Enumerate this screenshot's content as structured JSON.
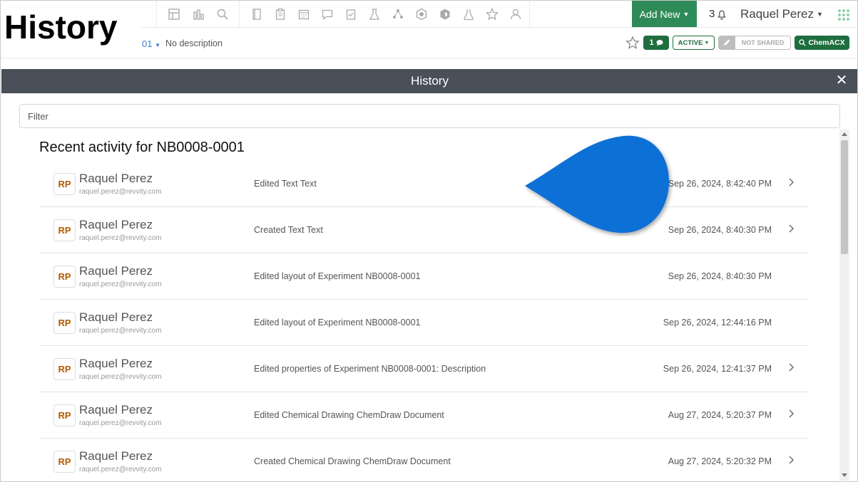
{
  "overlay_label": "History",
  "toolbar": {
    "group1_icons": [
      "dashboard-icon",
      "chart-icon",
      "search-icon"
    ],
    "group2_icons": [
      "notebook-icon",
      "clipboard-icon",
      "calendar-icon",
      "comment-icon",
      "task-icon",
      "lab-icon",
      "network-icon",
      "hexagon-icon",
      "cube-icon",
      "flask-icon",
      "star-icon",
      "people-icon"
    ],
    "add_new_label": "Add New",
    "notification_count": "3",
    "user_name": "Raquel Perez"
  },
  "experiment_bar": {
    "id_fragment": "01",
    "description": "No description",
    "comment_count": "1",
    "status_label": "ACTIVE",
    "sharing_label": "NOT SHARED",
    "chemacx_label": "ChemACX"
  },
  "modal": {
    "title": "History",
    "close_glyph": "✕",
    "filter_placeholder": "Filter",
    "heading": "Recent activity for NB0008-0001"
  },
  "activity": [
    {
      "initials": "RP",
      "name": "Raquel Perez",
      "email": "raquel.perez@revvity.com",
      "action": "Edited Text Text",
      "timestamp": "Sep 26, 2024, 8:42:40 PM",
      "has_details": true
    },
    {
      "initials": "RP",
      "name": "Raquel Perez",
      "email": "raquel.perez@revvity.com",
      "action": "Created Text Text",
      "timestamp": "Sep 26, 2024, 8:40:30 PM",
      "has_details": true
    },
    {
      "initials": "RP",
      "name": "Raquel Perez",
      "email": "raquel.perez@revvity.com",
      "action": "Edited layout of Experiment NB0008-0001",
      "timestamp": "Sep 26, 2024, 8:40:30 PM",
      "has_details": false
    },
    {
      "initials": "RP",
      "name": "Raquel Perez",
      "email": "raquel.perez@revvity.com",
      "action": "Edited layout of Experiment NB0008-0001",
      "timestamp": "Sep 26, 2024, 12:44:16 PM",
      "has_details": false
    },
    {
      "initials": "RP",
      "name": "Raquel Perez",
      "email": "raquel.perez@revvity.com",
      "action": "Edited properties of Experiment NB0008-0001: Description",
      "timestamp": "Sep 26, 2024, 12:41:37 PM",
      "has_details": true
    },
    {
      "initials": "RP",
      "name": "Raquel Perez",
      "email": "raquel.perez@revvity.com",
      "action": "Edited Chemical Drawing ChemDraw Document",
      "timestamp": "Aug 27, 2024, 5:20:37 PM",
      "has_details": true
    },
    {
      "initials": "RP",
      "name": "Raquel Perez",
      "email": "raquel.perez@revvity.com",
      "action": "Created Chemical Drawing ChemDraw Document",
      "timestamp": "Aug 27, 2024, 5:20:32 PM",
      "has_details": true
    }
  ],
  "colors": {
    "accent_green": "#2e8b57",
    "dark_green": "#1e6e3e",
    "header_gray": "#4a5059",
    "pointer_blue": "#0b6fd6",
    "avatar_text": "#b35a00"
  }
}
